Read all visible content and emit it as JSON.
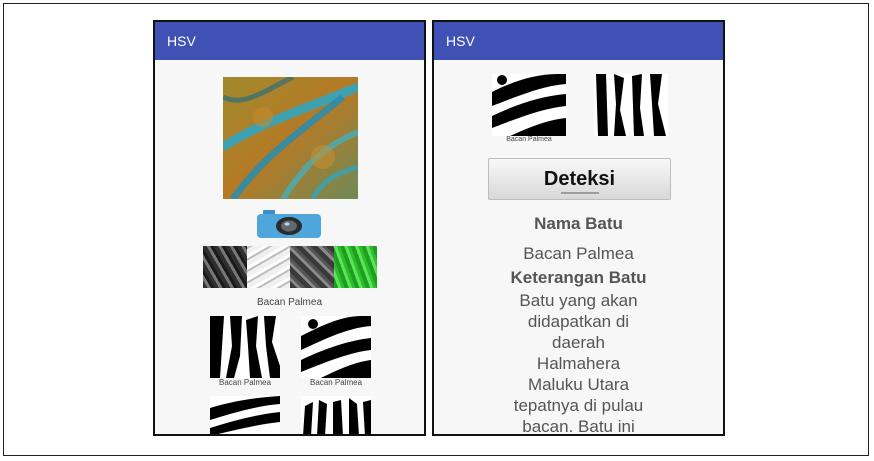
{
  "left_screen": {
    "app_title": "HSV",
    "caption_main": "Bacan Palmea",
    "caption_thumb1": "Bacan Palmea",
    "caption_thumb2": "Bacan Palmea"
  },
  "right_screen": {
    "app_title": "HSV",
    "caption_thumb1": "Bacan Palmea",
    "detect_button": "Deteksi",
    "name_heading": "Nama Batu",
    "name_value": "Bacan Palmea",
    "desc_heading": "Keterangan Batu",
    "desc_lines": [
      "Batu yang akan",
      "didapatkan di",
      "daerah",
      "Halmahera",
      "Maluku Utara",
      "tepatnya di pulau",
      "bacan. Batu ini"
    ]
  },
  "colors": {
    "appbar": "#3f51b5",
    "camera": "#4ea6dc"
  }
}
